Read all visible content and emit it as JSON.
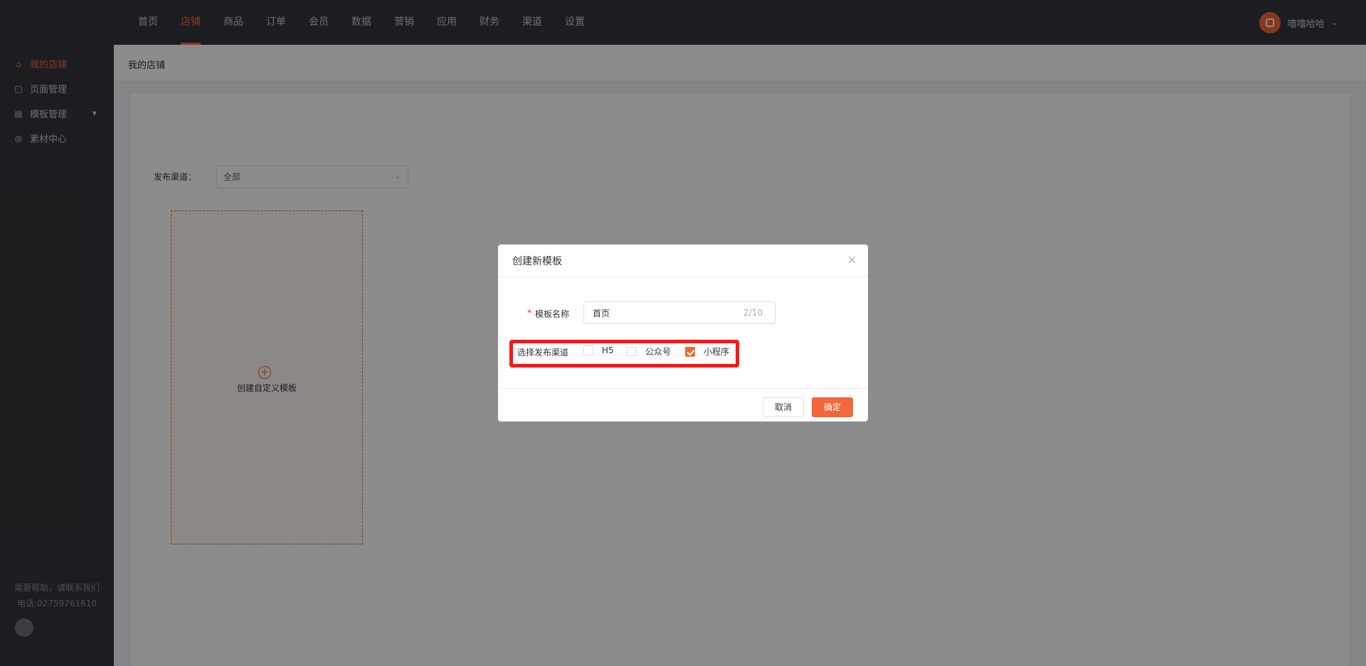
{
  "topnav": {
    "items": [
      {
        "label": "首页",
        "active": false
      },
      {
        "label": "店铺",
        "active": true
      },
      {
        "label": "商品",
        "active": false
      },
      {
        "label": "订单",
        "active": false
      },
      {
        "label": "会员",
        "active": false
      },
      {
        "label": "数据",
        "active": false
      },
      {
        "label": "营销",
        "active": false
      },
      {
        "label": "应用",
        "active": false
      },
      {
        "label": "财务",
        "active": false
      },
      {
        "label": "渠道",
        "active": false
      },
      {
        "label": "设置",
        "active": false
      }
    ],
    "username": "嘻嘻哈哈"
  },
  "sidebar": {
    "items": [
      {
        "label": "我的店铺",
        "icon": "shop-icon",
        "active": true
      },
      {
        "label": "页面管理",
        "icon": "page-icon",
        "active": false
      },
      {
        "label": "模板管理",
        "icon": "template-icon",
        "active": false
      },
      {
        "label": "素材中心",
        "icon": "material-icon",
        "active": false
      }
    ],
    "help_text": "需要帮助，请联系我们",
    "phone": "电话:02759761610"
  },
  "main": {
    "breadcrumb": "我的店铺",
    "filter_label": "发布渠道：",
    "filter_value": "全部",
    "create_card_label": "创建自定义模板"
  },
  "dialog": {
    "title": "创建新模板",
    "name_label": "模板名称",
    "name_value": "首页",
    "name_counter": "2/10",
    "channel_label": "选择发布渠道",
    "channels": [
      {
        "label": "H5",
        "checked": false
      },
      {
        "label": "公众号",
        "checked": false
      },
      {
        "label": "小程序",
        "checked": true
      }
    ],
    "cancel_label": "取消",
    "ok_label": "确定"
  },
  "colors": {
    "accent": "#f2673b",
    "nav_bg": "#34363b",
    "highlight": "#ff1414"
  }
}
